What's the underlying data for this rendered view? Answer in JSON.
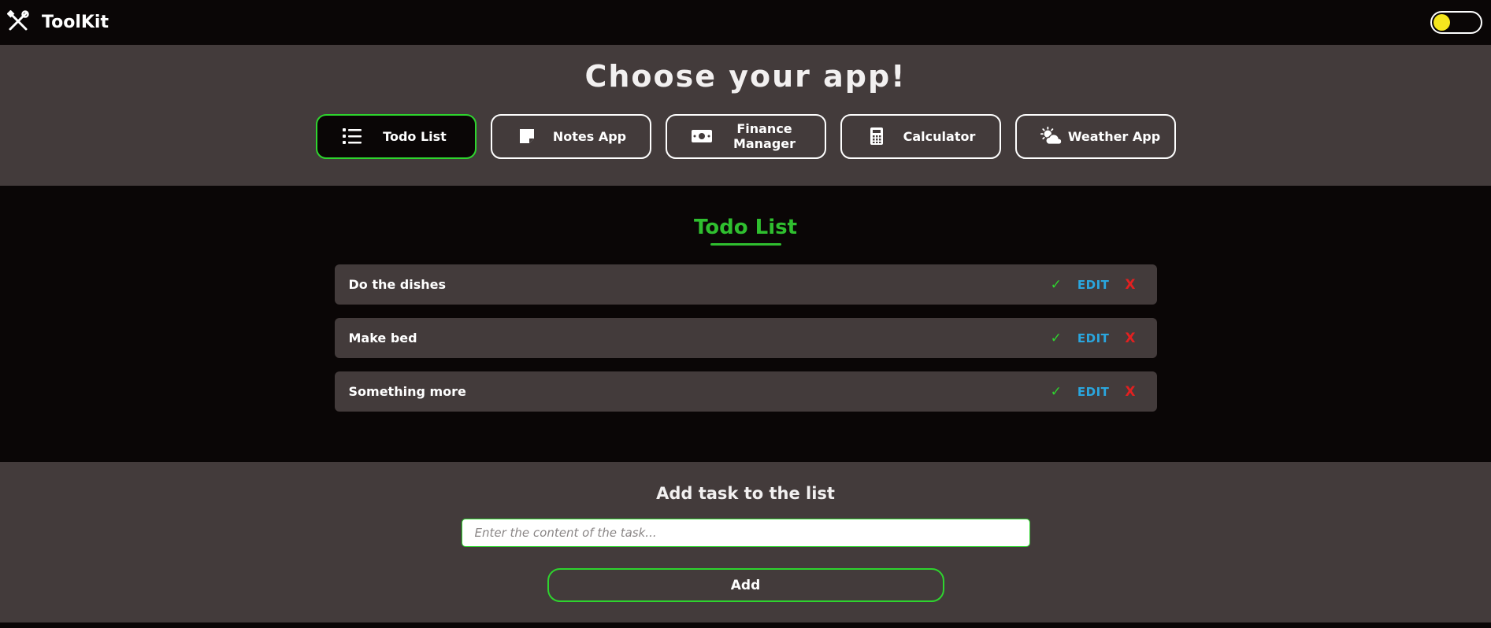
{
  "header": {
    "brand": "ToolKit",
    "brand_icon": "tools-icon",
    "theme_toggle": "theme-toggle"
  },
  "chooser": {
    "title": "Choose your app!",
    "apps": [
      {
        "label": "Todo List",
        "icon": "list-icon",
        "active": true
      },
      {
        "label": "Notes App",
        "icon": "sticky-note-icon",
        "active": false
      },
      {
        "label": "Finance Manager",
        "icon": "money-icon",
        "active": false
      },
      {
        "label": "Calculator",
        "icon": "calculator-icon",
        "active": false
      },
      {
        "label": "Weather App",
        "icon": "cloud-sun-icon",
        "active": false
      }
    ]
  },
  "todo": {
    "heading": "Todo List",
    "items": [
      {
        "text": "Do the dishes",
        "check": "✓",
        "edit": "EDIT",
        "delete": "X"
      },
      {
        "text": "Make bed",
        "check": "✓",
        "edit": "EDIT",
        "delete": "X"
      },
      {
        "text": "Something more",
        "check": "✓",
        "edit": "EDIT",
        "delete": "X"
      }
    ]
  },
  "add": {
    "title": "Add task to the list",
    "placeholder": "Enter the content of the task...",
    "value": "",
    "button": "Add"
  },
  "colors": {
    "accent_green": "#2ed42e",
    "heading_green": "#2fbf2f",
    "edit_blue": "#2aa6de",
    "delete_red": "#e22020",
    "panel_gray": "#433b3b",
    "background": "#0a0606",
    "toggle_knob": "#f5e61e"
  }
}
